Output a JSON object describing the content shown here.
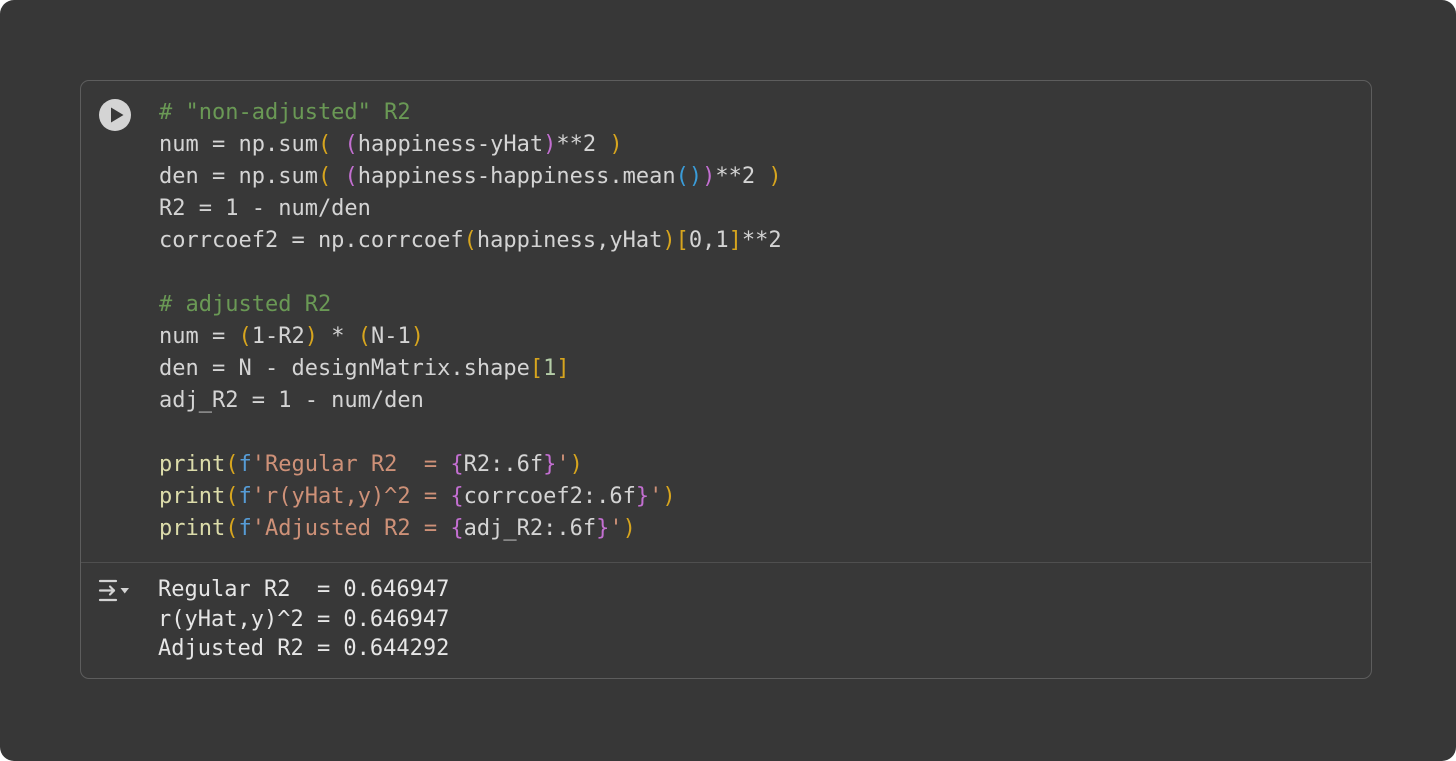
{
  "cell": {
    "run_icon": "play-circle-icon",
    "output_icon": "output-collapse-icon",
    "colors": {
      "comment": "#6a9955",
      "paren_gold": "#d7a51e",
      "paren_purple": "#c36fd1",
      "paren_blue": "#3a9cd9",
      "string": "#ce9178",
      "keyword_blue": "#569cd6",
      "number": "#b5cea8",
      "function": "#dcdcaa",
      "text": "#d4d4d4"
    },
    "code_lines": [
      [
        {
          "t": "# \"non-adjusted\" R2",
          "c": "comment"
        }
      ],
      [
        {
          "t": "num = np.sum",
          "c": "text"
        },
        {
          "t": "(",
          "c": "paren_gold"
        },
        {
          "t": " ",
          "c": "text"
        },
        {
          "t": "(",
          "c": "paren_purple"
        },
        {
          "t": "happiness-yHat",
          "c": "text"
        },
        {
          "t": ")",
          "c": "paren_purple"
        },
        {
          "t": "**2 ",
          "c": "text"
        },
        {
          "t": ")",
          "c": "paren_gold"
        }
      ],
      [
        {
          "t": "den = np.sum",
          "c": "text"
        },
        {
          "t": "(",
          "c": "paren_gold"
        },
        {
          "t": " ",
          "c": "text"
        },
        {
          "t": "(",
          "c": "paren_purple"
        },
        {
          "t": "happiness-happiness.mean",
          "c": "text"
        },
        {
          "t": "()",
          "c": "paren_blue"
        },
        {
          "t": ")",
          "c": "paren_purple"
        },
        {
          "t": "**2 ",
          "c": "text"
        },
        {
          "t": ")",
          "c": "paren_gold"
        }
      ],
      [
        {
          "t": "R2 = 1 - num/den",
          "c": "text"
        }
      ],
      [
        {
          "t": "corrcoef2 = np.corrcoef",
          "c": "text"
        },
        {
          "t": "(",
          "c": "paren_gold"
        },
        {
          "t": "happiness,yHat",
          "c": "text"
        },
        {
          "t": ")",
          "c": "paren_gold"
        },
        {
          "t": "[",
          "c": "paren_gold"
        },
        {
          "t": "0,1",
          "c": "text"
        },
        {
          "t": "]",
          "c": "paren_gold"
        },
        {
          "t": "**2",
          "c": "text"
        }
      ],
      [],
      [
        {
          "t": "# adjusted R2",
          "c": "comment"
        }
      ],
      [
        {
          "t": "num = ",
          "c": "text"
        },
        {
          "t": "(",
          "c": "paren_gold"
        },
        {
          "t": "1-R2",
          "c": "text"
        },
        {
          "t": ")",
          "c": "paren_gold"
        },
        {
          "t": " * ",
          "c": "text"
        },
        {
          "t": "(",
          "c": "paren_gold"
        },
        {
          "t": "N-1",
          "c": "text"
        },
        {
          "t": ")",
          "c": "paren_gold"
        }
      ],
      [
        {
          "t": "den = N - designMatrix.shape",
          "c": "text"
        },
        {
          "t": "[",
          "c": "paren_gold"
        },
        {
          "t": "1",
          "c": "number"
        },
        {
          "t": "]",
          "c": "paren_gold"
        }
      ],
      [
        {
          "t": "adj_R2 = 1 - num/den",
          "c": "text"
        }
      ],
      [],
      [
        {
          "t": "print",
          "c": "function"
        },
        {
          "t": "(",
          "c": "paren_gold"
        },
        {
          "t": "f",
          "c": "keyword_blue"
        },
        {
          "t": "'Regular R2  = ",
          "c": "string"
        },
        {
          "t": "{",
          "c": "paren_purple"
        },
        {
          "t": "R2:.6f",
          "c": "text"
        },
        {
          "t": "}",
          "c": "paren_purple"
        },
        {
          "t": "'",
          "c": "string"
        },
        {
          "t": ")",
          "c": "paren_gold"
        }
      ],
      [
        {
          "t": "print",
          "c": "function"
        },
        {
          "t": "(",
          "c": "paren_gold"
        },
        {
          "t": "f",
          "c": "keyword_blue"
        },
        {
          "t": "'r(yHat,y)^2 = ",
          "c": "string"
        },
        {
          "t": "{",
          "c": "paren_purple"
        },
        {
          "t": "corrcoef2:.6f",
          "c": "text"
        },
        {
          "t": "}",
          "c": "paren_purple"
        },
        {
          "t": "'",
          "c": "string"
        },
        {
          "t": ")",
          "c": "paren_gold"
        }
      ],
      [
        {
          "t": "print",
          "c": "function"
        },
        {
          "t": "(",
          "c": "paren_gold"
        },
        {
          "t": "f",
          "c": "keyword_blue"
        },
        {
          "t": "'Adjusted R2 = ",
          "c": "string"
        },
        {
          "t": "{",
          "c": "paren_purple"
        },
        {
          "t": "adj_R2:.6f",
          "c": "text"
        },
        {
          "t": "}",
          "c": "paren_purple"
        },
        {
          "t": "'",
          "c": "string"
        },
        {
          "t": ")",
          "c": "paren_gold"
        }
      ]
    ],
    "output_lines": [
      "Regular R2  = 0.646947",
      "r(yHat,y)^2 = 0.646947",
      "Adjusted R2 = 0.644292"
    ]
  }
}
